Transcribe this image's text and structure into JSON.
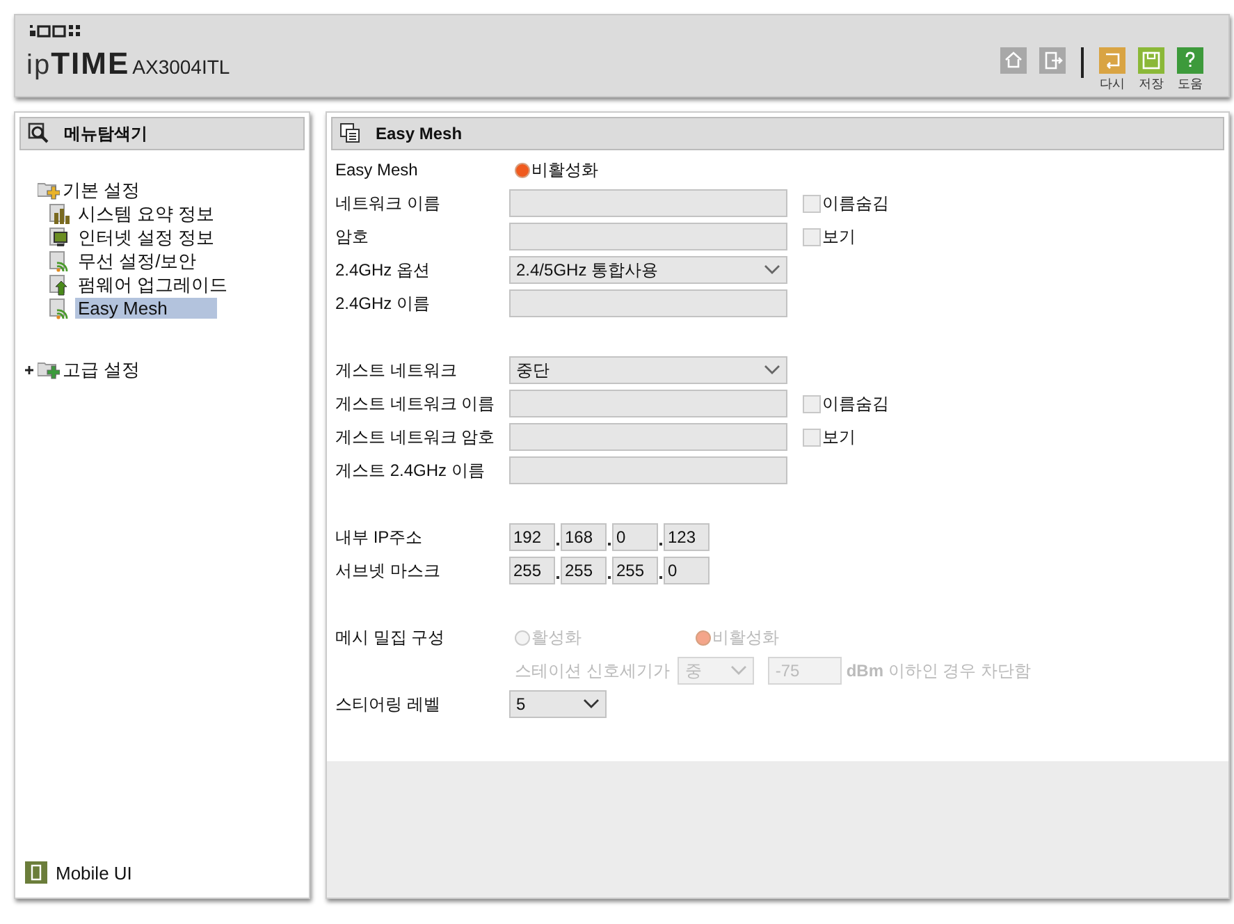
{
  "header": {
    "logo": {
      "prefix": "ip",
      "brand": "TIME",
      "model": "AX3004ITL"
    },
    "nav_buttons": [
      {
        "kind": "home"
      },
      {
        "kind": "logout"
      }
    ],
    "actions": [
      {
        "kind": "undo",
        "label": "다시"
      },
      {
        "kind": "save",
        "label": "저장"
      },
      {
        "kind": "help",
        "label": "도움"
      }
    ]
  },
  "sidebar": {
    "title": "메뉴탐색기",
    "tree": [
      {
        "label": "기본 설정",
        "kind": "basic",
        "expanded": true,
        "children": [
          {
            "label": "시스템 요약 정보",
            "kind": "chart",
            "selected": false
          },
          {
            "label": "인터넷 설정 정보",
            "kind": "monitor",
            "selected": false
          },
          {
            "label": "무선 설정/보안",
            "kind": "wireless",
            "selected": false
          },
          {
            "label": "펌웨어 업그레이드",
            "kind": "upgrade",
            "selected": false
          },
          {
            "label": "Easy Mesh",
            "kind": "wireless",
            "selected": true
          }
        ]
      },
      {
        "label": "고급 설정",
        "kind": "advanced",
        "expanded": false
      }
    ],
    "footer": "Mobile UI"
  },
  "main": {
    "title": "Easy Mesh",
    "rows": [
      {
        "kind": "radio",
        "label": "Easy Mesh",
        "disabled": false,
        "options": [
          {
            "label": "비활성화",
            "selected": true
          }
        ]
      },
      {
        "kind": "text",
        "label": "네트워크 이름",
        "checkbox": {
          "label": "이름숨김",
          "checked": false
        }
      },
      {
        "kind": "text",
        "label": "암호",
        "checkbox": {
          "label": "보기",
          "checked": false
        }
      },
      {
        "kind": "select",
        "label": "2.4GHz 옵션",
        "value": "2.4/5GHz 통합사용",
        "narrow": false
      },
      {
        "kind": "text",
        "label": "2.4GHz 이름"
      },
      {
        "kind": "gap"
      },
      {
        "kind": "select",
        "label": "게스트 네트워크",
        "value": "중단",
        "narrow": false
      },
      {
        "kind": "text",
        "label": "게스트 네트워크 이름",
        "checkbox": {
          "label": "이름숨김",
          "checked": false
        }
      },
      {
        "kind": "text",
        "label": "게스트 네트워크 암호",
        "checkbox": {
          "label": "보기",
          "checked": false
        }
      },
      {
        "kind": "text",
        "label": "게스트 2.4GHz 이름"
      },
      {
        "kind": "gap"
      },
      {
        "kind": "ip",
        "label": "내부 IP주소",
        "octets": [
          "192",
          "168",
          "0",
          "123"
        ]
      },
      {
        "kind": "ip",
        "label": "서브넷 마스크",
        "octets": [
          "255",
          "255",
          "255",
          "0"
        ]
      },
      {
        "kind": "gap"
      },
      {
        "kind": "radio",
        "label": "메시 밀집 구성",
        "disabled": true,
        "options": [
          {
            "label": "활성화",
            "selected": false
          },
          {
            "label": "비활성화",
            "selected": true
          }
        ]
      },
      {
        "kind": "threshold",
        "disabled": true,
        "prefix": "스테이션 신호세기가",
        "select": "중",
        "value": "-75",
        "suffix": "**dBm** 이하인 경우 차단함"
      },
      {
        "kind": "select",
        "label": "스티어링 레벨",
        "value": "5",
        "narrow": true
      }
    ]
  }
}
